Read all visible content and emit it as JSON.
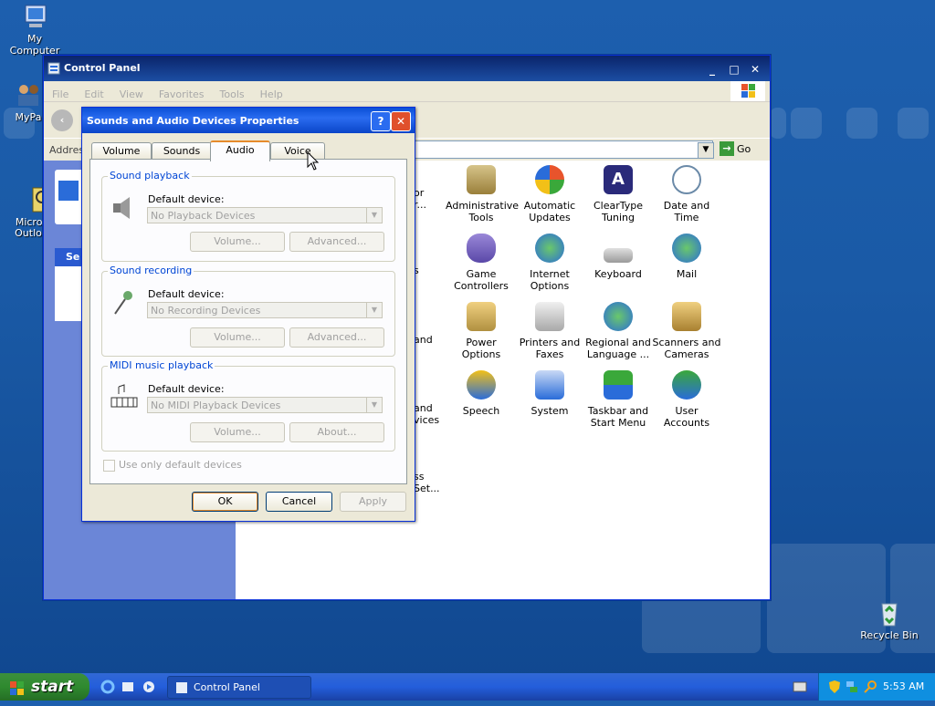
{
  "desktop": {
    "icons": [
      {
        "label": "My Computer"
      },
      {
        "label": "MyPa"
      },
      {
        "label": "Micros\nOutlo"
      },
      {
        "label": "Recycle Bin"
      }
    ]
  },
  "control_panel": {
    "title": "Control Panel",
    "menu": [
      "File",
      "Edit",
      "View",
      "Favorites",
      "Tools",
      "Help"
    ],
    "address_label": "Addres",
    "go_label": "Go",
    "left_pane_fragment": "Se",
    "items": [
      {
        "label": "Administrative Tools",
        "partial_left": "or\nr..."
      },
      {
        "label": "Automatic Updates"
      },
      {
        "label": "ClearType Tuning"
      },
      {
        "label": "Date and Time"
      },
      {
        "label": "Game Controllers",
        "partial_left": "s"
      },
      {
        "label": "Internet Options"
      },
      {
        "label": "Keyboard"
      },
      {
        "label": "Mail"
      },
      {
        "label": "Power Options",
        "partial_left": "and"
      },
      {
        "label": "Printers and Faxes"
      },
      {
        "label": "Regional and Language ..."
      },
      {
        "label": "Scanners and Cameras"
      },
      {
        "label": "Speech",
        "partial_left": "and\nvices"
      },
      {
        "label": "System"
      },
      {
        "label": "Taskbar and Start Menu"
      },
      {
        "label": "User Accounts"
      },
      {
        "label": "",
        "partial_left": "ss\nSet..."
      }
    ]
  },
  "dialog": {
    "title": "Sounds and Audio Devices Properties",
    "help_label": "?",
    "tabs": [
      {
        "label": "Volume"
      },
      {
        "label": "Sounds"
      },
      {
        "label": "Audio",
        "active": true
      },
      {
        "label": "Voice"
      }
    ],
    "groups": [
      {
        "caption": "Sound playback",
        "device_label": "Default device:",
        "selected": "No Playback Devices",
        "buttons": [
          "Volume...",
          "Advanced..."
        ]
      },
      {
        "caption": "Sound recording",
        "device_label": "Default device:",
        "selected": "No Recording Devices",
        "buttons": [
          "Volume...",
          "Advanced..."
        ]
      },
      {
        "caption": "MIDI music playback",
        "device_label": "Default device:",
        "selected": "No MIDI Playback Devices",
        "buttons": [
          "Volume...",
          "About..."
        ]
      }
    ],
    "checkbox_label": "Use only default devices",
    "ok_label": "OK",
    "cancel_label": "Cancel",
    "apply_label": "Apply"
  },
  "taskbar": {
    "start_label": "start",
    "task_label": "Control Panel",
    "clock": "5:53 AM"
  },
  "colors": {
    "desktop": "#1a5aa6",
    "xp_blue_title": "#0a4fd6",
    "start_green": "#2f8a2f",
    "tab_accent": "#e68b2c"
  }
}
